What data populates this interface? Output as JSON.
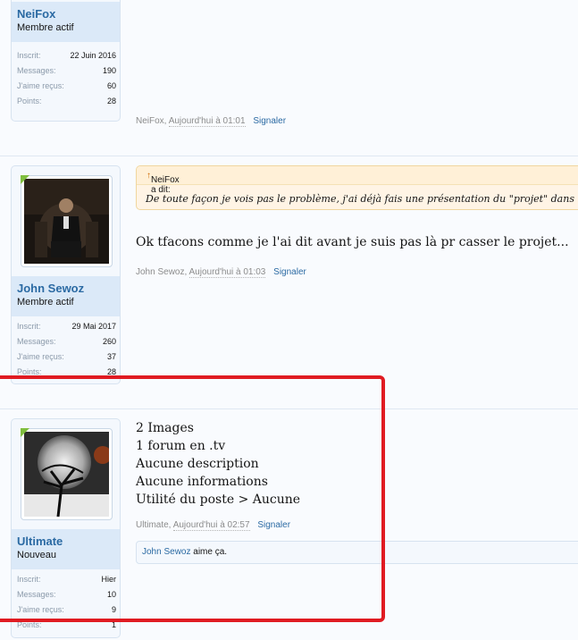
{
  "posts": [
    {
      "user": {
        "name": "NeiFox",
        "title": "Membre actif",
        "stats": [
          {
            "label": "Inscrit:",
            "value": "22 Juin 2016"
          },
          {
            "label": "Messages:",
            "value": "190"
          },
          {
            "label": "J'aime reçus:",
            "value": "60"
          },
          {
            "label": "Points:",
            "value": "28"
          }
        ]
      },
      "meta": {
        "author": "NeiFox,",
        "date": "Aujourd'hui à 01:01",
        "report": "Signaler"
      }
    },
    {
      "user": {
        "name": "John Sewoz",
        "title": "Membre actif",
        "stats": [
          {
            "label": "Inscrit:",
            "value": "29 Mai 2017"
          },
          {
            "label": "Messages:",
            "value": "260"
          },
          {
            "label": "J'aime reçus:",
            "value": "37"
          },
          {
            "label": "Points:",
            "value": "28"
          }
        ]
      },
      "quote": {
        "head": "NeiFox a dit:",
        "arrow": "↑",
        "body": "De toute façon je vois pas le problème, j'ai déjà fais une présentation du \"projet\" dans la se"
      },
      "message": "Ok tfacons comme je l'ai dit avant je suis pas là pr casser le projet...",
      "meta": {
        "author": "John Sewoz,",
        "date": "Aujourd'hui à 01:03",
        "report": "Signaler"
      }
    },
    {
      "user": {
        "name": "Ultimate",
        "title": "Nouveau",
        "stats": [
          {
            "label": "Inscrit:",
            "value": "Hier"
          },
          {
            "label": "Messages:",
            "value": "10"
          },
          {
            "label": "J'aime reçus:",
            "value": "9"
          },
          {
            "label": "Points:",
            "value": "1"
          }
        ]
      },
      "message_lines": [
        "2 Images",
        "1 forum en .tv",
        "Aucune description",
        "Aucune informations",
        "Utilité du poste > Aucune"
      ],
      "meta": {
        "author": "Ultimate,",
        "date": "Aujourd'hui à 02:57",
        "report": "Signaler"
      },
      "likes": {
        "who": "John Sewoz",
        "text": " aime ça."
      }
    }
  ],
  "colors": {
    "link": "#2b6aa3",
    "highlight": "#e01b22",
    "new_badge": "#7fbe3e"
  }
}
